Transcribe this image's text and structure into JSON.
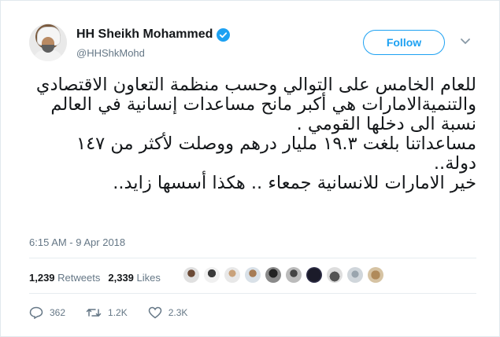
{
  "author": {
    "display_name": "HH Sheikh Mohammed",
    "handle": "@HHShkMohd",
    "verified": true
  },
  "follow_button": {
    "label": "Follow"
  },
  "tweet": {
    "lines": [
      "للعام الخامس على التوالي وحسب منظمة التعاون الاقتصادي",
      "والتنميةالامارات هي أكبر مانح مساعدات إنسانية في العالم",
      "نسبة الى دخلها القومي .",
      "مساعداتنا بلغت ١٩.٣ مليار درهم ووصلت لأكثر من ١٤٧",
      "دولة..",
      "خير الامارات للانسانية جمعاء .. هكذا أسسها زايد.."
    ],
    "timestamp": "6:15 AM - 9 Apr 2018"
  },
  "stats": {
    "retweets_count": "1,239",
    "retweets_label": "Retweets",
    "likes_count": "2,339",
    "likes_label": "Likes"
  },
  "actions": {
    "reply_count": "362",
    "retweet_count": "1.2K",
    "like_count": "2.3K"
  },
  "colors": {
    "accent": "#1da1f2",
    "muted": "#657786",
    "text": "#14171a"
  }
}
